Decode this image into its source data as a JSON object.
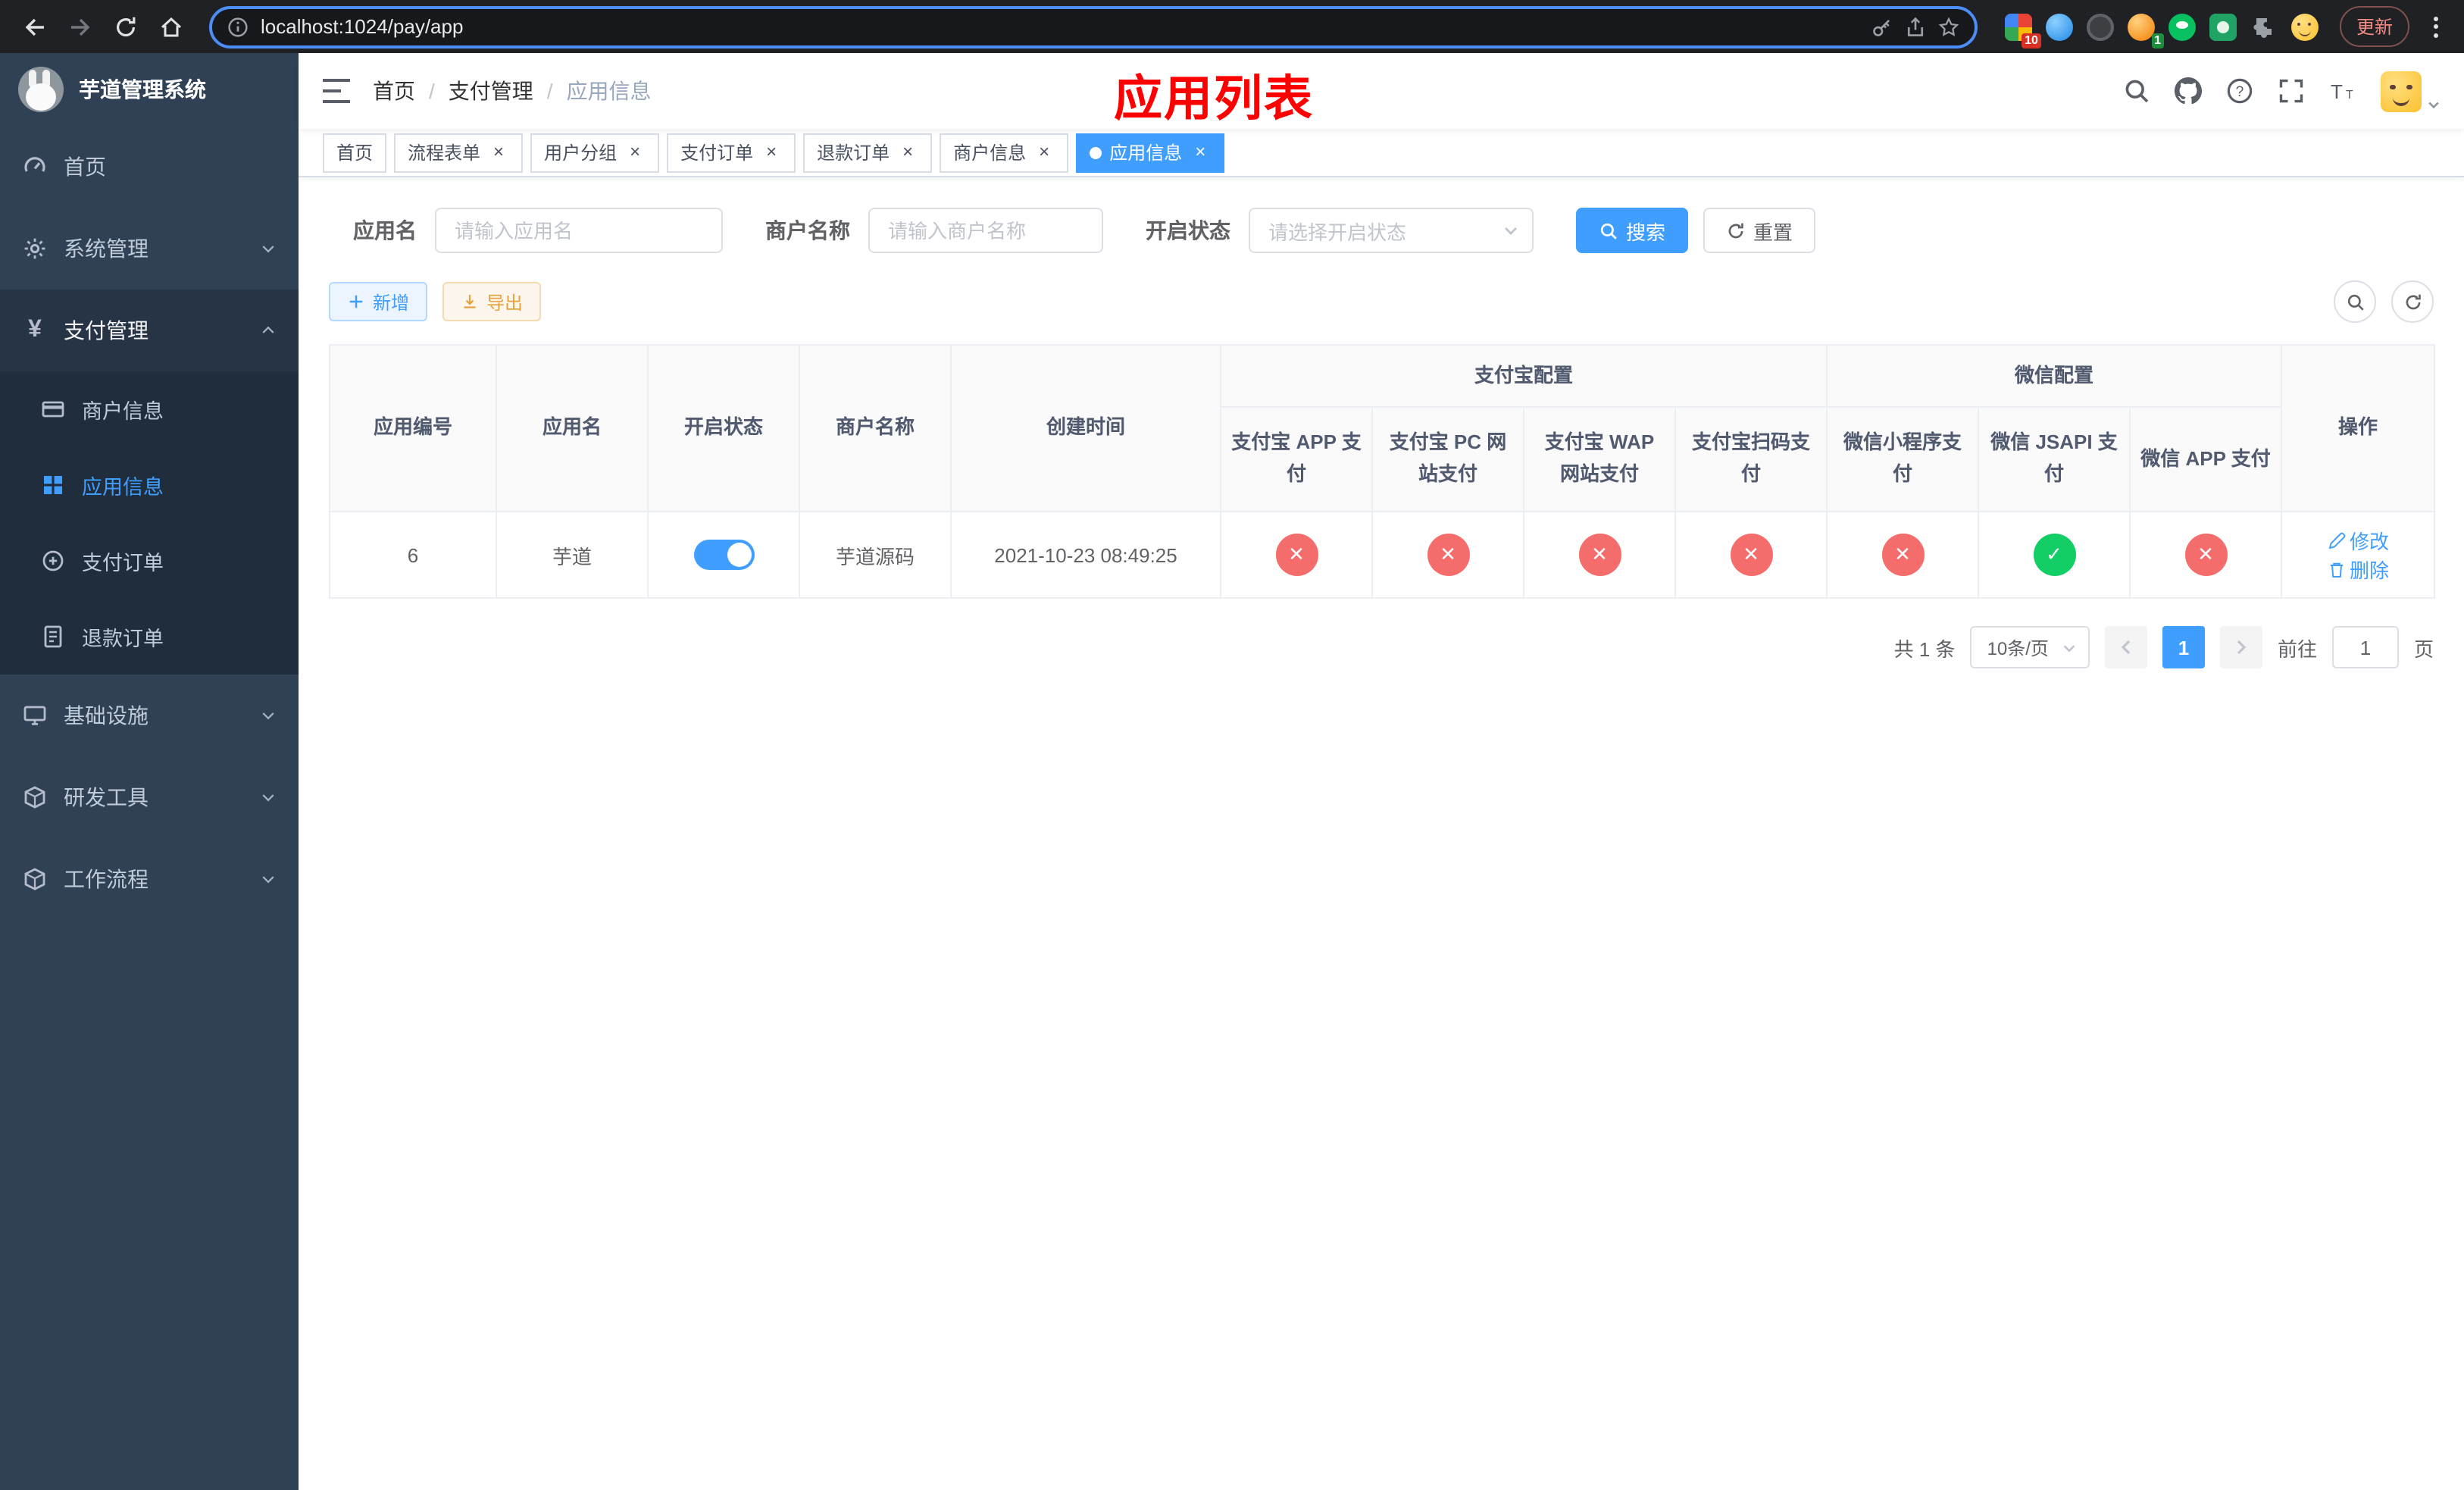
{
  "colors": {
    "accent": "#409eff",
    "danger": "#f56c6c",
    "success": "#13ce66",
    "warning": "#e6a23c",
    "annotation_red": "#ff0000",
    "sidebar_bg": "#304156"
  },
  "browser": {
    "url": "localhost:1024/pay/app",
    "update_label": "更新",
    "ext_badges": [
      "10",
      "1"
    ]
  },
  "sidebar": {
    "title": "芋道管理系统",
    "items": [
      {
        "label": "首页"
      },
      {
        "label": "系统管理"
      },
      {
        "label": "支付管理",
        "children": [
          {
            "label": "商户信息"
          },
          {
            "label": "应用信息"
          },
          {
            "label": "支付订单"
          },
          {
            "label": "退款订单"
          }
        ]
      },
      {
        "label": "基础设施"
      },
      {
        "label": "研发工具"
      },
      {
        "label": "工作流程"
      }
    ]
  },
  "header": {
    "breadcrumb": [
      "首页",
      "支付管理",
      "应用信息"
    ],
    "annotation": "应用列表"
  },
  "tabs": [
    {
      "label": "首页"
    },
    {
      "label": "流程表单"
    },
    {
      "label": "用户分组"
    },
    {
      "label": "支付订单"
    },
    {
      "label": "退款订单"
    },
    {
      "label": "商户信息"
    },
    {
      "label": "应用信息"
    }
  ],
  "filters": {
    "app_name_label": "应用名",
    "app_name_placeholder": "请输入应用名",
    "merchant_label": "商户名称",
    "merchant_placeholder": "请输入商户名称",
    "status_label": "开启状态",
    "status_placeholder": "请选择开启状态",
    "search_label": "搜索",
    "reset_label": "重置"
  },
  "toolbar": {
    "add_label": "新增",
    "export_label": "导出"
  },
  "table": {
    "columns": [
      "应用编号",
      "应用名",
      "开启状态",
      "商户名称",
      "创建时间"
    ],
    "alipay_group": {
      "label": "支付宝配置",
      "children": [
        "支付宝 APP 支付",
        "支付宝 PC 网站支付",
        "支付宝 WAP 网站支付",
        "支付宝扫码支付"
      ]
    },
    "wechat_group": {
      "label": "微信配置",
      "children": [
        "微信小程序支付",
        "微信 JSAPI 支付",
        "微信 APP 支付"
      ]
    },
    "ops_label": "操作",
    "row": {
      "id": "6",
      "name": "芋道",
      "enabled": true,
      "merchant": "芋道源码",
      "created_at": "2021-10-23 08:49:25",
      "configs": [
        false,
        false,
        false,
        false,
        false,
        true,
        false
      ],
      "edit_label": "修改",
      "delete_label": "删除"
    }
  },
  "pagination": {
    "total_text": "共 1 条",
    "page_size_text": "10条/页",
    "page": "1",
    "goto_prefix": "前往",
    "goto_value": "1",
    "goto_suffix": "页"
  }
}
